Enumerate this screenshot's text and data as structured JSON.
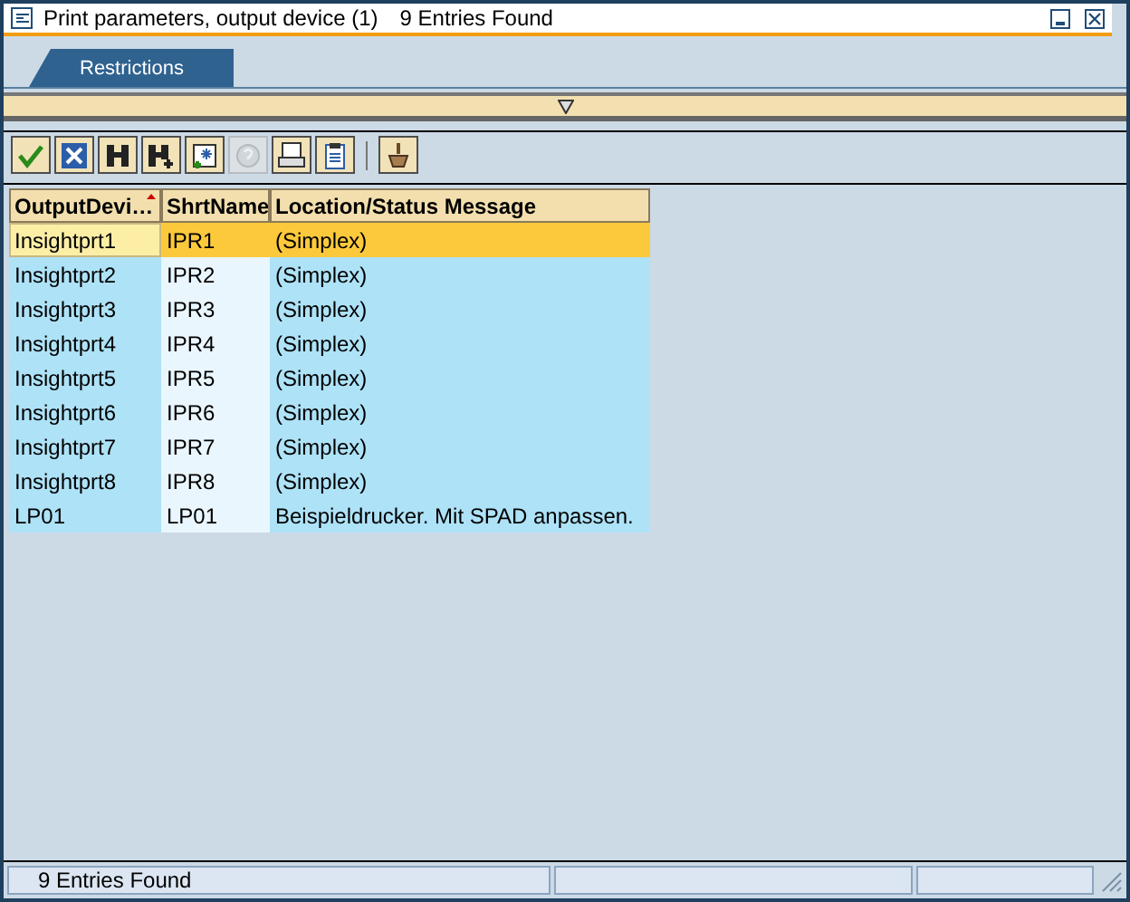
{
  "window": {
    "title": "Print parameters, output device (1)",
    "subtitle": "9 Entries Found"
  },
  "tabs": [
    {
      "label": "Restrictions",
      "selected": true
    }
  ],
  "toolbar": [
    {
      "kind": "check",
      "disabled": false
    },
    {
      "kind": "cancel",
      "disabled": false
    },
    {
      "kind": "find",
      "disabled": false
    },
    {
      "kind": "find-next",
      "disabled": false
    },
    {
      "kind": "new",
      "disabled": false
    },
    {
      "kind": "help",
      "disabled": true
    },
    {
      "kind": "print",
      "disabled": false
    },
    {
      "kind": "clipboard",
      "disabled": false
    }
  ],
  "toolbar_extra": [
    {
      "kind": "tool",
      "disabled": false
    }
  ],
  "table": {
    "columns": [
      {
        "label": "OutputDevi…",
        "sorted": true
      },
      {
        "label": "ShrtName",
        "sorted": false
      },
      {
        "label": "Location/Status Message",
        "sorted": false
      }
    ],
    "rows": [
      {
        "cells": [
          "Insightprt1",
          "IPR1",
          "(Simplex)"
        ],
        "selected": true
      },
      {
        "cells": [
          "Insightprt2",
          "IPR2",
          "(Simplex)"
        ],
        "selected": false
      },
      {
        "cells": [
          "Insightprt3",
          "IPR3",
          "(Simplex)"
        ],
        "selected": false
      },
      {
        "cells": [
          "Insightprt4",
          "IPR4",
          "(Simplex)"
        ],
        "selected": false
      },
      {
        "cells": [
          "Insightprt5",
          "IPR5",
          "(Simplex)"
        ],
        "selected": false
      },
      {
        "cells": [
          "Insightprt6",
          "IPR6",
          "(Simplex)"
        ],
        "selected": false
      },
      {
        "cells": [
          "Insightprt7",
          "IPR7",
          "(Simplex)"
        ],
        "selected": false
      },
      {
        "cells": [
          "Insightprt8",
          "IPR8",
          "(Simplex)"
        ],
        "selected": false
      },
      {
        "cells": [
          "LP01",
          "LP01",
          "Beispieldrucker. Mit SPAD anpassen."
        ],
        "selected": false
      }
    ]
  },
  "status_bar": {
    "message": "9 Entries Found"
  }
}
